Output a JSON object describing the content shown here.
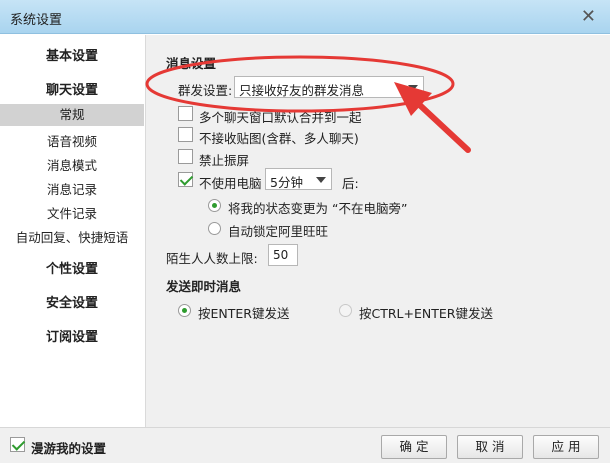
{
  "window": {
    "title": "系统设置",
    "close_glyph": "✕"
  },
  "sidebar": {
    "groups": [
      {
        "label": "基本设置"
      },
      {
        "label": "聊天设置"
      },
      {
        "label": "个性设置"
      },
      {
        "label": "安全设置"
      },
      {
        "label": "订阅设置"
      }
    ],
    "chat_items": [
      {
        "label": "常规",
        "active": true
      },
      {
        "label": "语音视频"
      },
      {
        "label": "消息模式"
      },
      {
        "label": "消息记录"
      },
      {
        "label": "文件记录"
      },
      {
        "label": "自动回复、快捷短语"
      }
    ]
  },
  "main": {
    "message_settings": {
      "title": "消息设置",
      "group_send_label": "群发设置:",
      "group_send_value": "只接收好友的群发消息",
      "merge_windows": {
        "label": "多个聊天窗口默认合并到一起",
        "checked": false
      },
      "no_stickers": {
        "label": "不接收贴图(含群、多人聊天)",
        "checked": false
      },
      "no_shake": {
        "label": "禁止振屏",
        "checked": false
      },
      "idle": {
        "prefix": "不使用电脑",
        "value": "5分钟",
        "suffix": "后:",
        "checked": true
      },
      "idle_option_away": {
        "label": "将我的状态变更为 “不在电脑旁”",
        "selected": true
      },
      "idle_option_lock": {
        "label": "自动锁定阿里旺旺",
        "selected": false
      },
      "stranger_limit_label": "陌生人人数上限:",
      "stranger_limit_value": "50"
    },
    "send_im": {
      "title": "发送即时消息",
      "option_enter": {
        "label": "按ENTER键发送",
        "selected": true
      },
      "option_ctrl_enter": {
        "label": "按CTRL+ENTER键发送",
        "selected": false
      }
    }
  },
  "footer": {
    "roaming": {
      "label": "漫游我的设置",
      "checked": true
    },
    "ok_label": "确 定",
    "cancel_label": "取 消",
    "apply_label": "应 用"
  },
  "colors": {
    "annotation": "#e53935",
    "check_green": "#2f9c2f",
    "titlebar": "#b8ddf3"
  }
}
